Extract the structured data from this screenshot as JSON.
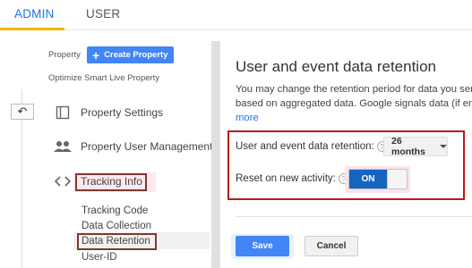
{
  "top_tabs": {
    "admin": "ADMIN",
    "user": "USER"
  },
  "property": {
    "label": "Property",
    "create_button": "Create Property",
    "name": "Optimize Smart Live Property"
  },
  "nav": {
    "back_icon": "arrow-left-icon",
    "items": [
      {
        "label": "Property Settings",
        "icon": "property-settings-icon"
      },
      {
        "label": "Property User Management",
        "icon": "people-icon"
      },
      {
        "label": "Tracking Info",
        "icon": "code-brackets-icon"
      }
    ],
    "sub_items": [
      "Tracking Code",
      "Data Collection",
      "Data Retention",
      "User-ID"
    ]
  },
  "main": {
    "title": "User and event data retention",
    "desc_line1": "You may change the retention period for data you send",
    "desc_line2": "based on aggregated data. Google signals data (if enab",
    "desc_more": "more",
    "retention_label": "User and event data retention:",
    "retention_value": "26 months",
    "reset_label": "Reset on new activity:",
    "toggle_state": "ON",
    "help_glyph": "?",
    "save": "Save",
    "cancel": "Cancel"
  },
  "colors": {
    "accent": "#4285f4",
    "tab_active": "#1a73e8",
    "highlight_box": "#b71c1c",
    "toggle_on": "#1565c0"
  }
}
